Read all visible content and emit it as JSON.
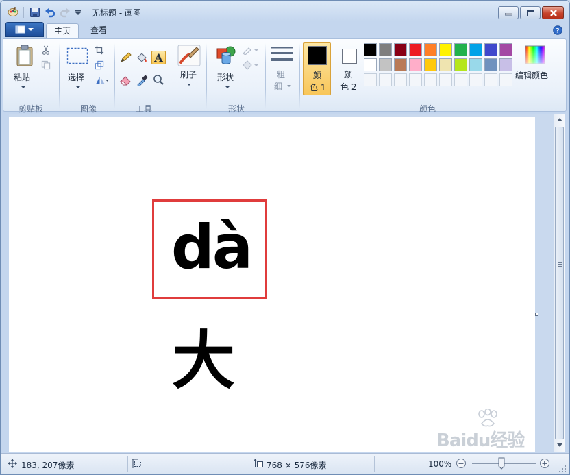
{
  "titlebar": {
    "title": "无标题 - 画图",
    "app_icon": "paint-app-icon",
    "quick_access": [
      "save-icon",
      "undo-icon",
      "redo-icon",
      "customize-dropdown-icon"
    ],
    "controls": [
      "minimize-icon",
      "maximize-icon",
      "close-icon"
    ]
  },
  "tabs": {
    "file_menu_icon": "file-menu-icon",
    "home": "主页",
    "view": "查看",
    "help_icon": "help-icon"
  },
  "ribbon": {
    "clipboard": {
      "label": "剪贴板",
      "paste": "粘贴",
      "icons": [
        "paste-icon",
        "cut-icon",
        "copy-icon"
      ]
    },
    "image": {
      "label": "图像",
      "select": "选择",
      "icons": [
        "select-icon",
        "crop-icon",
        "resize-icon",
        "rotate-icon"
      ]
    },
    "tools": {
      "label": "工具",
      "icons": [
        "pencil-icon",
        "fill-icon",
        "text-icon",
        "eraser-icon",
        "color-picker-icon",
        "magnifier-icon"
      ]
    },
    "brushes": {
      "label": "刷子",
      "icon": "brush-icon"
    },
    "shapes": {
      "label": "形状",
      "shapes_button": "形状",
      "icons": [
        "shapes-icon",
        "outline-icon",
        "shape-fill-icon"
      ]
    },
    "size": {
      "line1": "粗",
      "line2": "细",
      "icon": "line-size-icon"
    },
    "colors": {
      "label": "颜色",
      "color1_line1": "颜",
      "color1_line2": "色 1",
      "color2_line1": "颜",
      "color2_line2": "色 2",
      "color1_value": "#000000",
      "color2_value": "#ffffff",
      "edit_colors": "编辑颜色",
      "edit_icon": "edit-colors-icon",
      "palette_row1": [
        "#000000",
        "#7f7f7f",
        "#880015",
        "#ed1c24",
        "#ff7f27",
        "#fff200",
        "#22b14c",
        "#00a2e8",
        "#3f48cc",
        "#a349a4"
      ],
      "palette_row2": [
        "#ffffff",
        "#c3c3c3",
        "#b97a57",
        "#ffaec9",
        "#ffc90e",
        "#efe4b0",
        "#b5e61d",
        "#99d9ea",
        "#7092be",
        "#c8bfe7"
      ]
    }
  },
  "canvas": {
    "pinyin": "dà",
    "hanzi": "大",
    "highlight_color": "#e03c3c"
  },
  "watermark": {
    "text": "Baidu经验",
    "icon": "baidu-paw-icon"
  },
  "statusbar": {
    "cursor_pos": "183, 207像素",
    "canvas_size": "768 × 576像素",
    "zoom": "100%",
    "icons": [
      "cursor-position-icon",
      "selection-size-icon",
      "canvas-size-icon",
      "zoom-out-icon",
      "zoom-slider-icon",
      "zoom-in-icon"
    ]
  }
}
